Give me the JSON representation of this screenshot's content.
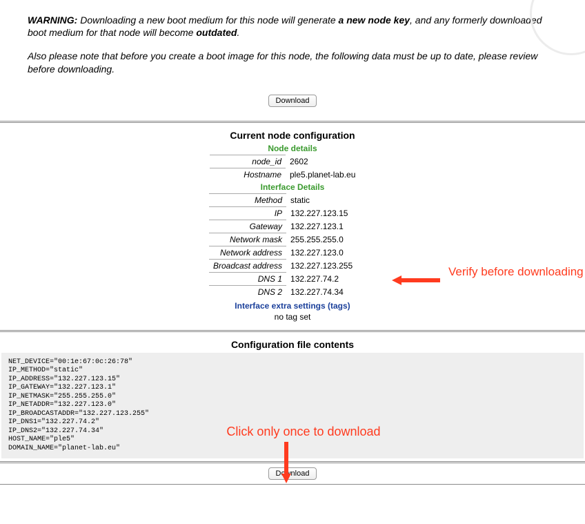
{
  "warning": {
    "prefix": "WARNING:",
    "text1": " Downloading a new boot medium for this node will generate ",
    "bold1": "a new node key",
    "text2": ", and any formerly downloaded boot medium for that node will become ",
    "bold2": "outdated",
    "text3": "."
  },
  "note": "Also please note that before you create a boot image for this node, the following data must be up to date, please review before downloading.",
  "button_label": "Download",
  "section_config_title": "Current node configuration",
  "node_details_label": "Node details",
  "interface_details_label": "Interface Details",
  "interface_tags_label": "Interface extra settings (tags)",
  "no_tag_text": "no tag set",
  "node_rows": [
    {
      "label": "node_id",
      "value": "2602"
    },
    {
      "label": "Hostname",
      "value": "ple5.planet-lab.eu"
    }
  ],
  "iface_rows": [
    {
      "label": "Method",
      "value": "static"
    },
    {
      "label": "IP",
      "value": "132.227.123.15"
    },
    {
      "label": "Gateway",
      "value": "132.227.123.1"
    },
    {
      "label": "Network mask",
      "value": "255.255.255.0"
    },
    {
      "label": "Network address",
      "value": "132.227.123.0"
    },
    {
      "label": "Broadcast address",
      "value": "132.227.123.255"
    },
    {
      "label": "DNS 1",
      "value": "132.227.74.2"
    },
    {
      "label": "DNS 2",
      "value": "132.227.74.34"
    }
  ],
  "section_file_title": "Configuration file contents",
  "config_file": "NET_DEVICE=\"00:1e:67:0c:26:78\"\nIP_METHOD=\"static\"\nIP_ADDRESS=\"132.227.123.15\"\nIP_GATEWAY=\"132.227.123.1\"\nIP_NETMASK=\"255.255.255.0\"\nIP_NETADDR=\"132.227.123.0\"\nIP_BROADCASTADDR=\"132.227.123.255\"\nIP_DNS1=\"132.227.74.2\"\nIP_DNS2=\"132.227.74.34\"\nHOST_NAME=\"ple5\"\nDOMAIN_NAME=\"planet-lab.eu\"",
  "annotation_verify": "Verify before downloading",
  "annotation_click": "Click only once to download"
}
